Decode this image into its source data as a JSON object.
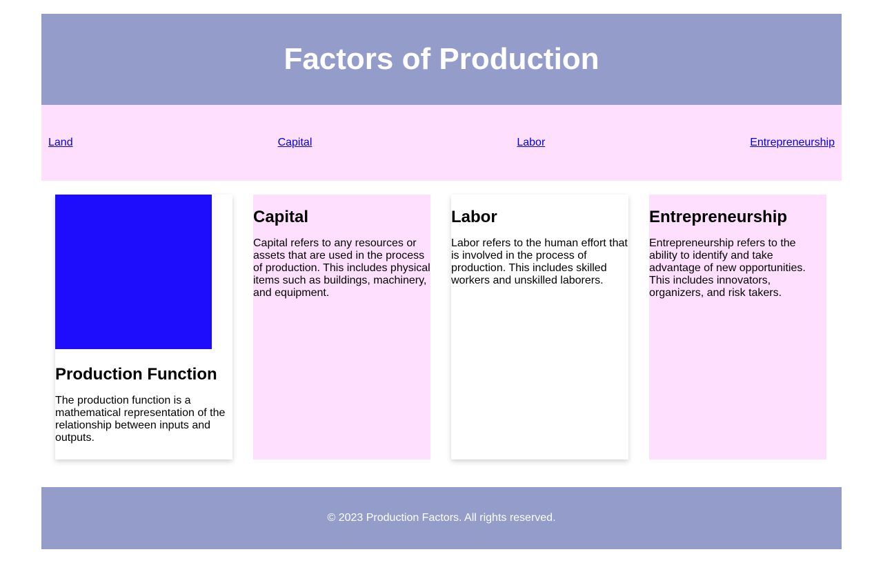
{
  "header": {
    "title": "Factors of Production"
  },
  "nav": {
    "links": [
      "Land",
      "Capital",
      "Labor",
      "Entrepreneurship"
    ]
  },
  "cards": [
    {
      "title": "Production Function",
      "text": "The production function is a mathematical representation of the relationship between inputs and outputs."
    },
    {
      "title": "Capital",
      "text": "Capital refers to any resources or assets that are used in the process of production. This includes physical items such as buildings, machinery, and equipment."
    },
    {
      "title": "Labor",
      "text": "Labor refers to the human effort that is involved in the process of production. This includes skilled workers and unskilled laborers."
    },
    {
      "title": "Entrepreneurship",
      "text": "Entrepreneurship refers to the ability to identify and take advantage of new opportunities. This includes innovators, organizers, and risk takers."
    }
  ],
  "footer": {
    "text": "© 2023 Production Factors. All rights reserved."
  },
  "colors": {
    "header_bg": "#949cc9",
    "nav_bg": "#ffdffe",
    "image_placeholder": "#1e0dfd",
    "link": "#0000ee"
  }
}
